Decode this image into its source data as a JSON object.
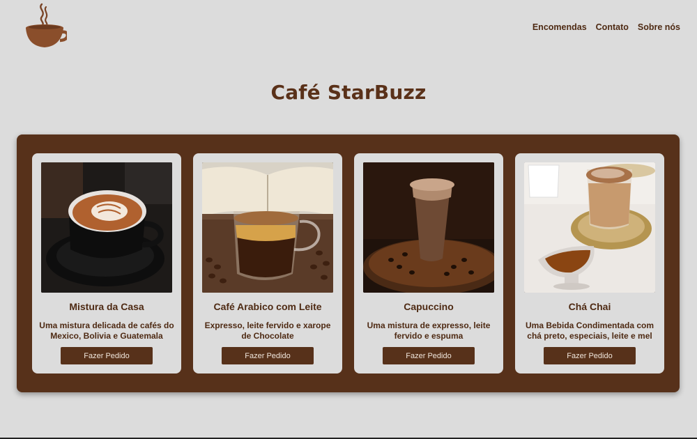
{
  "header": {
    "logo_icon": "coffee-cup-steam-icon",
    "nav": [
      "Encomendas",
      "Contato",
      "Sobre nós"
    ]
  },
  "page_title": "Café StarBuzz",
  "colors": {
    "background": "#dcdcdc",
    "brand_brown": "#57311a",
    "text_brown": "#4e2a13"
  },
  "products": [
    {
      "name": "Mistura da Casa",
      "description": "Uma mistura delicada de cafés do Mexico, Bolivia e Guatemala",
      "button": "Fazer Pedido",
      "image": "latte-art-cup-photo"
    },
    {
      "name": "Café Arabico com Leite",
      "description": "Expresso, leite fervido e xarope de Chocolate",
      "button": "Fazer Pedido",
      "image": "glass-coffee-with-book-photo"
    },
    {
      "name": "Capuccino",
      "description": "Uma mistura de expresso, leite fervido e espuma",
      "button": "Fazer Pedido",
      "image": "iced-cappuccino-cup-photo"
    },
    {
      "name": "Chá Chai",
      "description": "Uma Bebida Condimentada com chá preto, especiais, leite e mel",
      "button": "Fazer Pedido",
      "image": "chai-latte-glass-photo"
    }
  ]
}
